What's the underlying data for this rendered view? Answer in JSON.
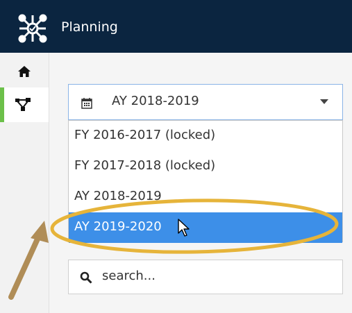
{
  "header": {
    "title": "Planning",
    "logo_icon": "network-nodes-logo",
    "background": "#0b2540"
  },
  "sidebar": {
    "items": [
      {
        "icon": "home-icon",
        "active": false
      },
      {
        "icon": "sitemap-icon",
        "active": true
      }
    ],
    "active_color": "#6cc04a"
  },
  "year_select": {
    "icon": "calendar-icon",
    "selected": "AY 2018-2019",
    "options": [
      "FY 2016-2017 (locked)",
      "FY 2017-2018 (locked)",
      "AY 2018-2019",
      "AY 2019-2020"
    ],
    "highlighted_index": 3,
    "highlight_color": "#3d8fe8"
  },
  "search": {
    "icon": "search-icon",
    "placeholder": "search..."
  },
  "annotation": {
    "ellipse_color": "#e6b43a",
    "arrow_color": "#b08d57"
  }
}
